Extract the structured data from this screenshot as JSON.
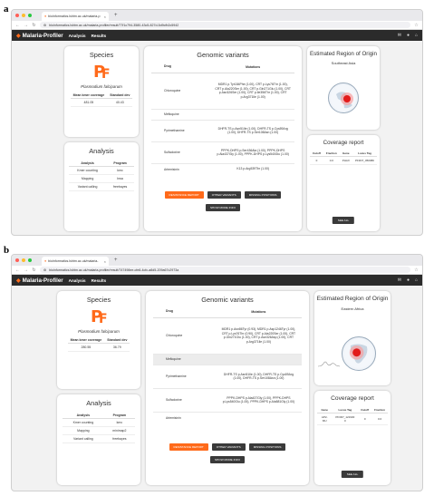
{
  "panel_a": {
    "letter": "a",
    "browser": {
      "tab_title": "bioinformatics.lshtm.ac.uk/malaria-p",
      "url": "bioinformatics.lshtm.ac.uk/malaria-profiler/result/77f1c794-3580-43c5-827d-5d9cfb2c5942"
    },
    "app": {
      "brand": "Malaria-Profiler",
      "nav": [
        "Analysis",
        "Results"
      ]
    },
    "species": {
      "title": "Species",
      "name": "Plasmodium falciparum",
      "headers": [
        "Mean kmer coverage",
        "Standard dev"
      ],
      "values": [
        "481.05",
        "40.43"
      ]
    },
    "analysis": {
      "title": "Analysis",
      "headers": [
        "Analysis",
        "Program"
      ],
      "rows": [
        [
          "Kmer counting",
          "kmc"
        ],
        [
          "Mapping",
          "bwa"
        ],
        [
          "Variant calling",
          "freebayes"
        ]
      ]
    },
    "variants": {
      "title": "Genomic variants",
      "headers": [
        "Drug",
        "Mutations"
      ],
      "rows": [
        [
          "Chloroquine",
          "MDR1 p.Tyr184Phe (1.00), CRT p.Lys76Thr (1.00), CRT p.Ala220Ser (1.00), CRT p.Gln271Glu (1.00), CRT p.Asn326Ser (1.00), CRT p.Ile356Thr (1.00), CRT p.Arg371Ile (1.00)"
        ],
        [
          "Mefloquine",
          ""
        ],
        [
          "Pyrimethamine",
          "DHFR-TS p.Asn51Ile (1.00), DHFR-TS p.Cys59Arg (1.00), DHFR-TS p.Ser108Asn (1.00)"
        ],
        [
          "Sulfadoxine",
          "PPPK-DHPS p.Ser436Ala (1.00), PPPK-DHPS p.Ala437Gly (1.00), PPPK-DHPS p.Lys540Glu (1.00)"
        ],
        [
          "Artemisinin",
          "K13 p.Arg539Thr (1.00)"
        ]
      ],
      "buttons": [
        "RESISTANCE REPORT",
        "OTHER VARIANTS",
        "MISSING POSITIONS"
      ],
      "more_button": "SHOW MORE INFO"
    },
    "region": {
      "title": "Estimated Region of Origin",
      "label": "Southeast Asia"
    },
    "coverage": {
      "title": "Coverage report",
      "headers": [
        "Cutoff",
        "Fraction",
        "Gene",
        "Locus Tag"
      ],
      "row": [
        "0",
        "0.0",
        "PHAX",
        "PF3D7_050980"
      ],
      "see_all": "SEE ALL"
    }
  },
  "panel_b": {
    "letter": "b",
    "browser": {
      "tab_title": "bioinformatics.lshtm.ac.uk/malaria-",
      "url": "bioinformatics.lshtm.ac.uk/malaria-profiler/result/747498ee-cfe8-4cfc-a8d5-209a67c2973a"
    },
    "app": {
      "brand": "Malaria-Profiler",
      "nav": [
        "Analysis",
        "Results"
      ]
    },
    "species": {
      "title": "Species",
      "name": "Plasmodium falciparum",
      "headers": [
        "Mean kmer coverage",
        "Standard dev"
      ],
      "values": [
        "280.55",
        "36.79"
      ]
    },
    "analysis": {
      "title": "Analysis",
      "headers": [
        "Analysis",
        "Program"
      ],
      "rows": [
        [
          "Kmer counting",
          "kmc"
        ],
        [
          "Mapping",
          "minimap2"
        ],
        [
          "Variant calling",
          "freebayes"
        ]
      ]
    },
    "variants": {
      "title": "Genomic variants",
      "headers": [
        "Drug",
        "Mutations"
      ],
      "rows": [
        [
          "Chloroquine",
          "MDR1 p.Asn86Tyr (0.93), MDR1 p.Asp1246Tyr (1.00), CRT p.Lys76Thr (0.90), CRT p.Ala220Ser (1.00), CRT p.Gln271Glu (1.00), CRT p.Asn326Asp (1.00), CRT p.Arg371Ile (1.00)"
        ],
        [
          "Mefloquine",
          ""
        ],
        [
          "Pyrimethamine",
          "DHFR-TS p.Asn51Ile (1.00), DHFR-TS p.Cys59Arg (1.00), DHFR-TS p.Ser108Asn (1.00)"
        ],
        [
          "Sulfadoxine",
          "PPPK-DHPS p.Ala437Gly (1.00), PPPK-DHPS p.Lys540Glu (1.00), PPPK-DHPS p.Ala581Gly (1.00)"
        ],
        [
          "Artemisinin",
          ""
        ]
      ],
      "buttons": [
        "RESISTANCE REPORT",
        "OTHER VARIANTS",
        "MISSING POSITIONS"
      ],
      "more_button": "SHOW MORE INFO"
    },
    "region": {
      "title": "Estimated Region of Origin",
      "label": "Eastern Africa"
    },
    "coverage": {
      "title": "Coverage report",
      "headers": [
        "Gene",
        "Locus Tag",
        "Cutoff",
        "Fraction"
      ],
      "row": [
        "AP2-MU",
        "PF3D7_121930 0",
        "0",
        "0.0"
      ],
      "see_all": "SEE ALL"
    }
  },
  "colors": {
    "accent": "#ff6a1a",
    "appbar": "#2b2b2b",
    "background": "#f2f2f2",
    "map_marker": "#e21b1b"
  }
}
